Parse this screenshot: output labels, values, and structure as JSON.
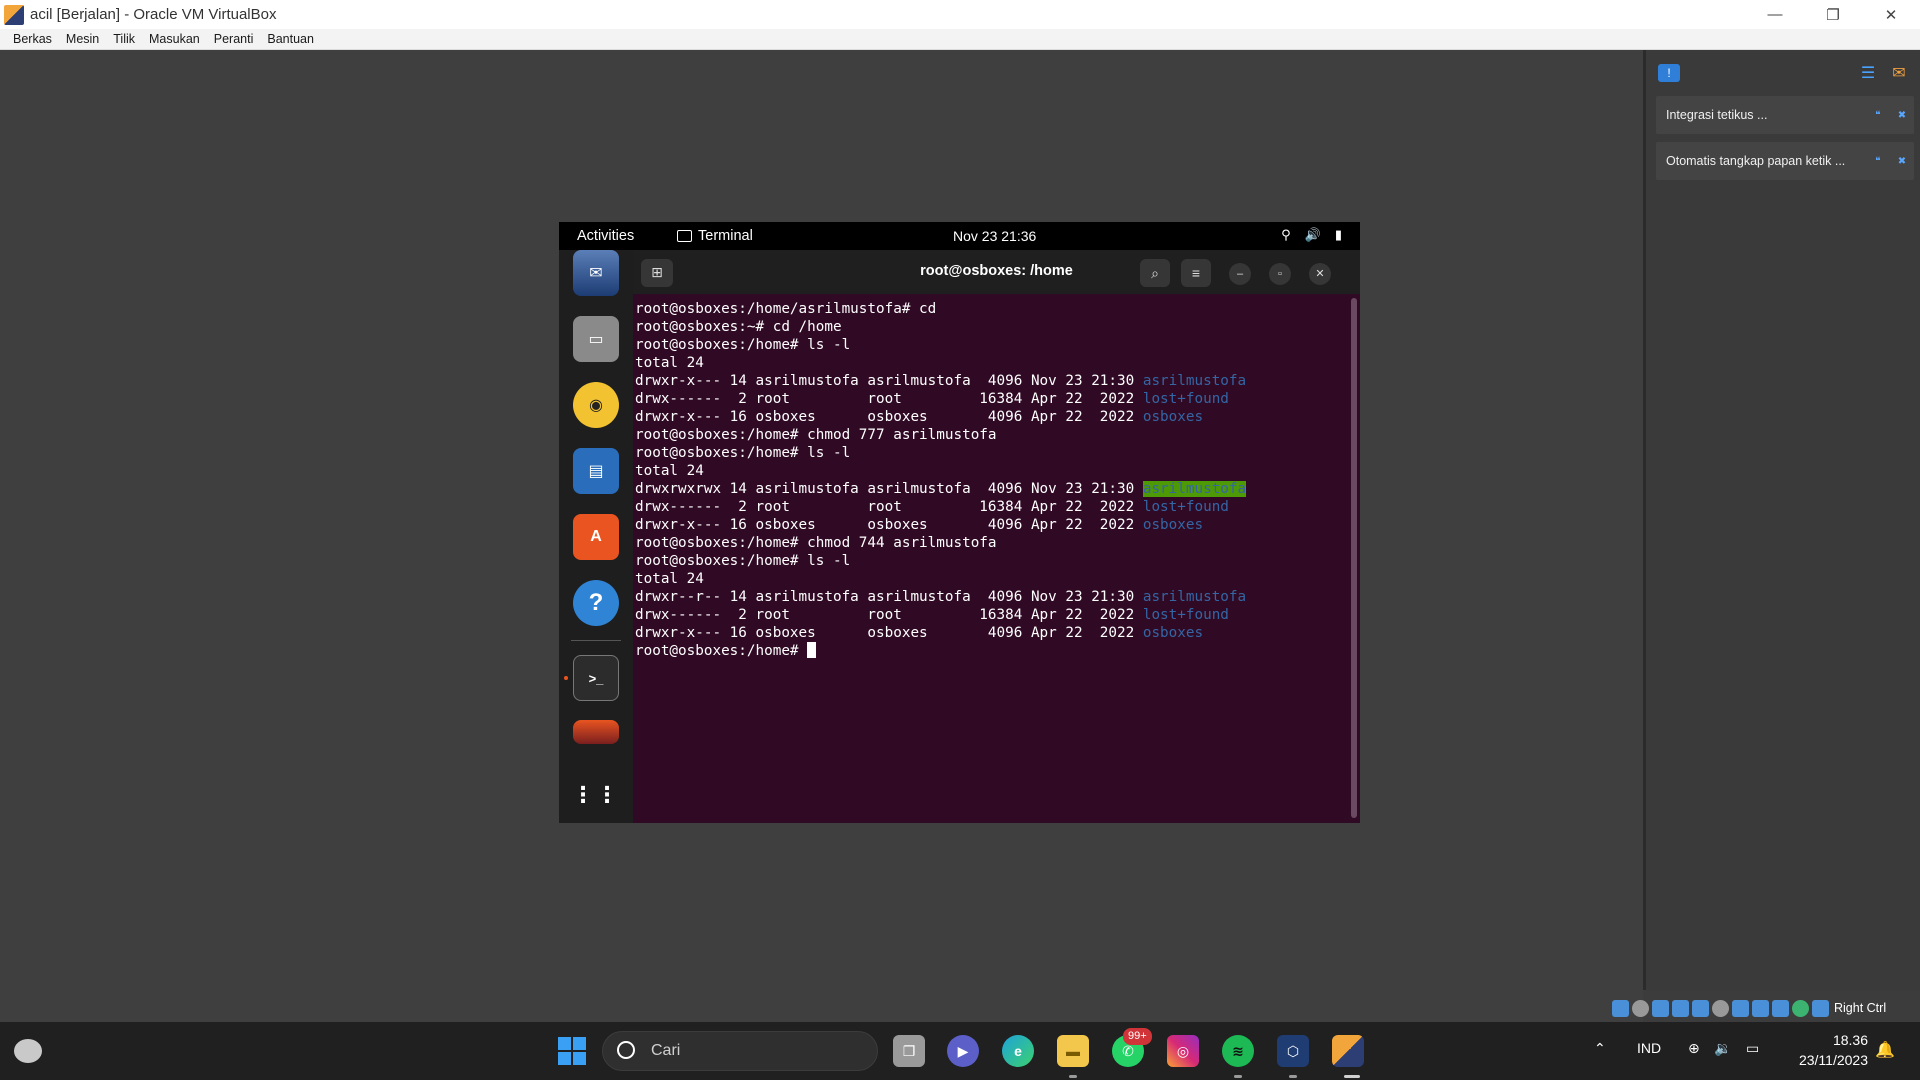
{
  "window": {
    "title": "acil [Berjalan] - Oracle VM VirtualBox",
    "controls": {
      "minimize": "—",
      "restore": "❐",
      "close": "✕"
    }
  },
  "menubar": [
    "Berkas",
    "Mesin",
    "Tilik",
    "Masukan",
    "Peranti",
    "Bantuan"
  ],
  "notifications": {
    "cards": [
      {
        "text": "Integrasi tetikus ..."
      },
      {
        "text": "Otomatis tangkap papan ketik ..."
      }
    ]
  },
  "statusbar": {
    "host_key": "Right Ctrl"
  },
  "gnome": {
    "activities": "Activities",
    "app_name": "Terminal",
    "clock": "Nov 23  21:36"
  },
  "terminal": {
    "title": "root@osboxes: /home",
    "lines": [
      [
        "root@osboxes:/home/asrilmustofa# cd"
      ],
      [
        "root@osboxes:~# cd /home"
      ],
      [
        "root@osboxes:/home# ls -l"
      ],
      [
        "total 24"
      ],
      [
        "drwxr-x--- 14 asrilmustofa asrilmustofa  4096 Nov 23 21:30 ",
        "asrilmustofa"
      ],
      [
        "drwx------  2 root         root         16384 Apr 22  2022 ",
        "lost+found"
      ],
      [
        "drwxr-x--- 16 osboxes      osboxes       4096 Apr 22  2022 ",
        "osboxes"
      ],
      [
        "root@osboxes:/home# chmod 777 asrilmustofa"
      ],
      [
        "root@osboxes:/home# ls -l"
      ],
      [
        "total 24"
      ],
      [
        "drwxrwxrwx 14 asrilmustofa asrilmustofa  4096 Nov 23 21:30 ",
        "asrilmustofa"
      ],
      [
        "drwx------  2 root         root         16384 Apr 22  2022 ",
        "lost+found"
      ],
      [
        "drwxr-x--- 16 osboxes      osboxes       4096 Apr 22  2022 ",
        "osboxes"
      ],
      [
        "root@osboxes:/home# chmod 744 asrilmustofa"
      ],
      [
        "root@osboxes:/home# ls -l"
      ],
      [
        "total 24"
      ],
      [
        "drwxr--r-- 14 asrilmustofa asrilmustofa  4096 Nov 23 21:30 ",
        "asrilmustofa"
      ],
      [
        "drwx------  2 root         root         16384 Apr 22  2022 ",
        "lost+found"
      ],
      [
        "drwxr-x--- 16 osboxes      osboxes       4096 Apr 22  2022 ",
        "osboxes"
      ]
    ],
    "prompt": "root@osboxes:/home# "
  },
  "taskbar": {
    "search_placeholder": "Cari",
    "whatsapp_badge": "99+",
    "language": "IND",
    "time": "18.36",
    "date": "23/11/2023"
  }
}
